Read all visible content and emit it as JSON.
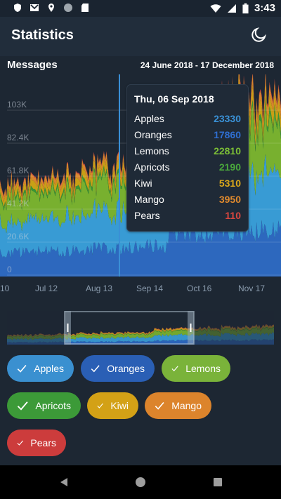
{
  "status_bar": {
    "time": "3:43"
  },
  "app_bar": {
    "title": "Statistics"
  },
  "section": {
    "title": "Messages",
    "date_range": "24 June 2018 - 17 December 2018"
  },
  "chart_data": {
    "type": "area",
    "y_ticks": [
      "0",
      "20.6K",
      "41.2K",
      "61.8K",
      "82.4K",
      "103K"
    ],
    "x_tick_labels": [
      "10",
      "Jul 12",
      "Aug 13",
      "Sep 14",
      "Oct 16",
      "Nov 17"
    ],
    "grid": true,
    "series": [
      {
        "name": "Apples",
        "color": "#3aa1dd"
      },
      {
        "name": "Oranges",
        "color": "#2e6cc6"
      },
      {
        "name": "Lemons",
        "color": "#7db72f"
      },
      {
        "name": "Apricots",
        "color": "#3a9b35"
      },
      {
        "name": "Kiwi",
        "color": "#d2a715"
      },
      {
        "name": "Mango",
        "color": "#e2892d"
      },
      {
        "name": "Pears",
        "color": "#d74343"
      }
    ]
  },
  "tooltip": {
    "date": "Thu, 06 Sep 2018",
    "rows": [
      {
        "name": "Apples",
        "value": "23330",
        "color": "#3a91d6"
      },
      {
        "name": "Oranges",
        "value": "17860",
        "color": "#2f6ed0"
      },
      {
        "name": "Lemons",
        "value": "22810",
        "color": "#7cbf36"
      },
      {
        "name": "Apricots",
        "value": "2190",
        "color": "#4aa83c"
      },
      {
        "name": "Kiwi",
        "value": "5310",
        "color": "#dba81b"
      },
      {
        "name": "Mango",
        "value": "3950",
        "color": "#e08a2e"
      },
      {
        "name": "Pears",
        "value": "110",
        "color": "#d9463f"
      }
    ]
  },
  "filters": [
    {
      "label": "Apples",
      "color": "#3a90d0"
    },
    {
      "label": "Oranges",
      "color": "#2a5fb5"
    },
    {
      "label": "Lemons",
      "color": "#7ab33a"
    },
    {
      "label": "Apricots",
      "color": "#3c9a38"
    },
    {
      "label": "Kiwi",
      "color": "#d3a116"
    },
    {
      "label": "Mango",
      "color": "#dc842c"
    },
    {
      "label": "Pears",
      "color": "#cc3c3c"
    }
  ]
}
